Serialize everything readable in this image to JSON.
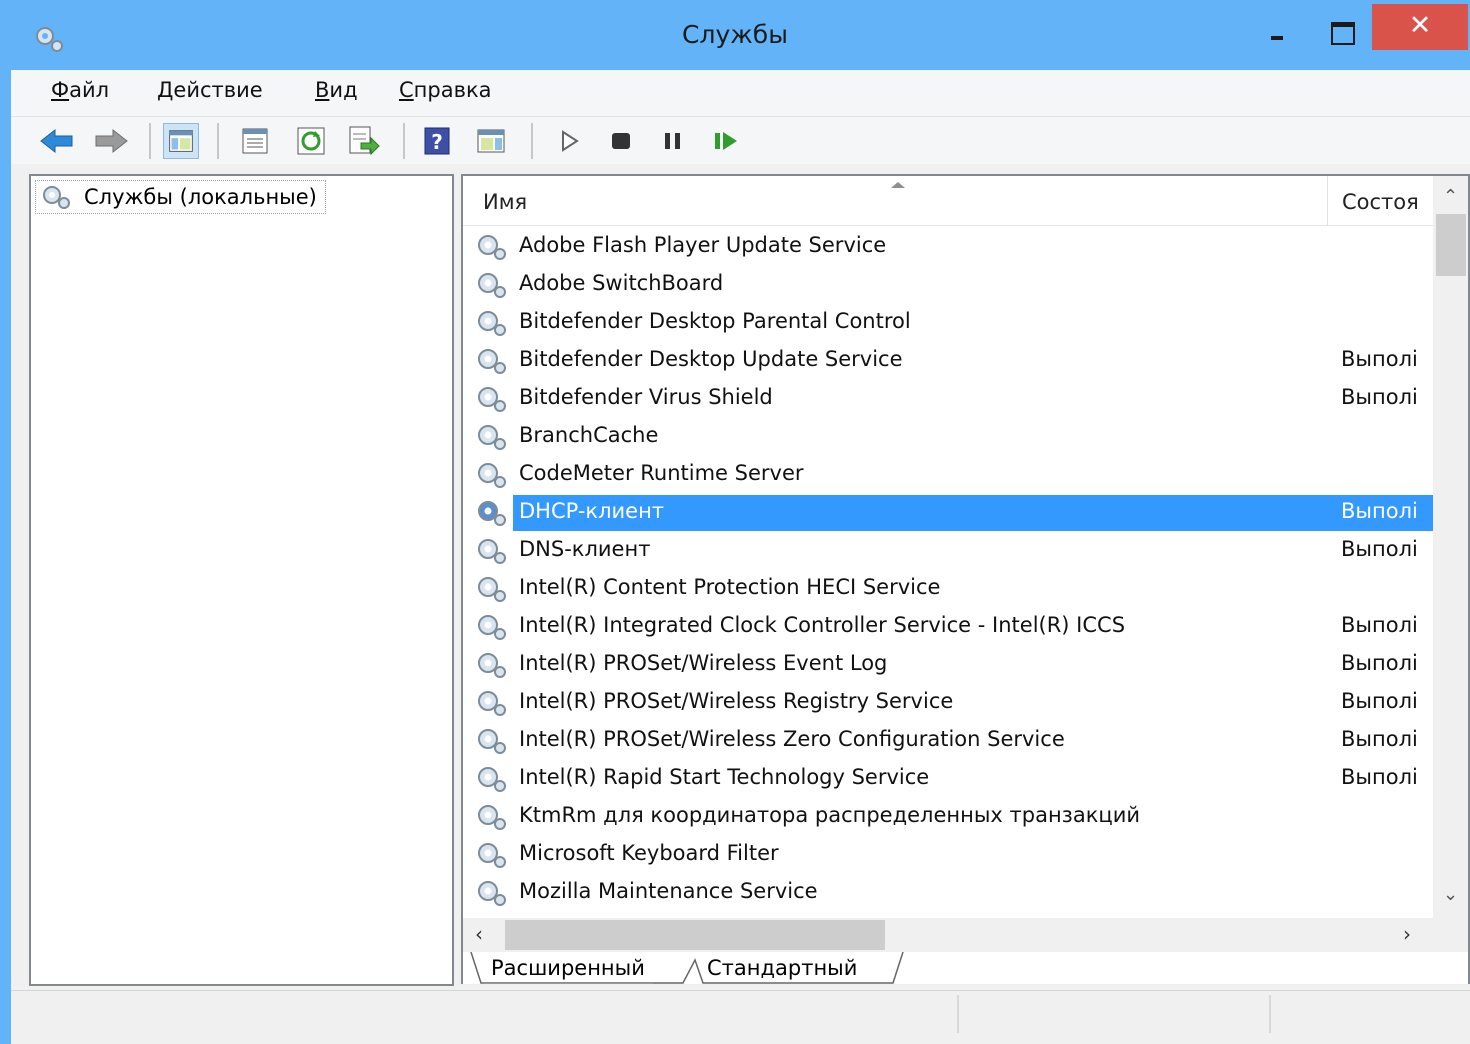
{
  "window": {
    "title": "Службы"
  },
  "menu": [
    {
      "accel": "Ф",
      "rest": "айл"
    },
    {
      "accel": "Д",
      "rest": "ействие"
    },
    {
      "accel": "В",
      "rest": "ид"
    },
    {
      "accel": "С",
      "rest": "правка"
    }
  ],
  "toolbar": {
    "icons": [
      "back-arrow-icon",
      "forward-arrow-icon",
      "show-hide-console-tree-icon",
      "properties-icon",
      "refresh-icon",
      "export-list-icon",
      "help-icon",
      "show-action-pane-icon",
      "start-service-icon",
      "stop-service-icon",
      "pause-service-icon",
      "restart-service-icon"
    ]
  },
  "tree": {
    "root": "Службы (локальные)"
  },
  "list": {
    "columns": {
      "name": "Имя",
      "status": "Состоя"
    },
    "rows": [
      {
        "name": "Adobe Flash Player Update Service",
        "status": ""
      },
      {
        "name": "Adobe SwitchBoard",
        "status": ""
      },
      {
        "name": "Bitdefender Desktop Parental Control",
        "status": ""
      },
      {
        "name": "Bitdefender Desktop Update Service",
        "status": "Выполі"
      },
      {
        "name": "Bitdefender Virus Shield",
        "status": "Выполі"
      },
      {
        "name": "BranchCache",
        "status": ""
      },
      {
        "name": "CodeMeter Runtime Server",
        "status": ""
      },
      {
        "name": "DHCP-клиент",
        "status": "Выполі",
        "selected": true
      },
      {
        "name": "DNS-клиент",
        "status": "Выполі"
      },
      {
        "name": "Intel(R) Content Protection HECI Service",
        "status": ""
      },
      {
        "name": "Intel(R) Integrated Clock Controller Service - Intel(R) ICCS",
        "status": "Выполі"
      },
      {
        "name": "Intel(R) PROSet/Wireless Event Log",
        "status": "Выполі"
      },
      {
        "name": "Intel(R) PROSet/Wireless Registry Service",
        "status": "Выполі"
      },
      {
        "name": "Intel(R) PROSet/Wireless Zero Configuration Service",
        "status": "Выполі"
      },
      {
        "name": "Intel(R) Rapid Start Technology Service",
        "status": "Выполі"
      },
      {
        "name": "KtmRm для координатора распределенных транзакций",
        "status": ""
      },
      {
        "name": "Microsoft Keyboard Filter",
        "status": ""
      },
      {
        "name": "Mozilla Maintenance Service",
        "status": ""
      }
    ]
  },
  "tabs": {
    "extended": "Расширенный",
    "standard": "Стандартный"
  },
  "colors": {
    "titlebar": "#62b3f7",
    "close": "#d9534a",
    "selection": "#3399ff"
  }
}
